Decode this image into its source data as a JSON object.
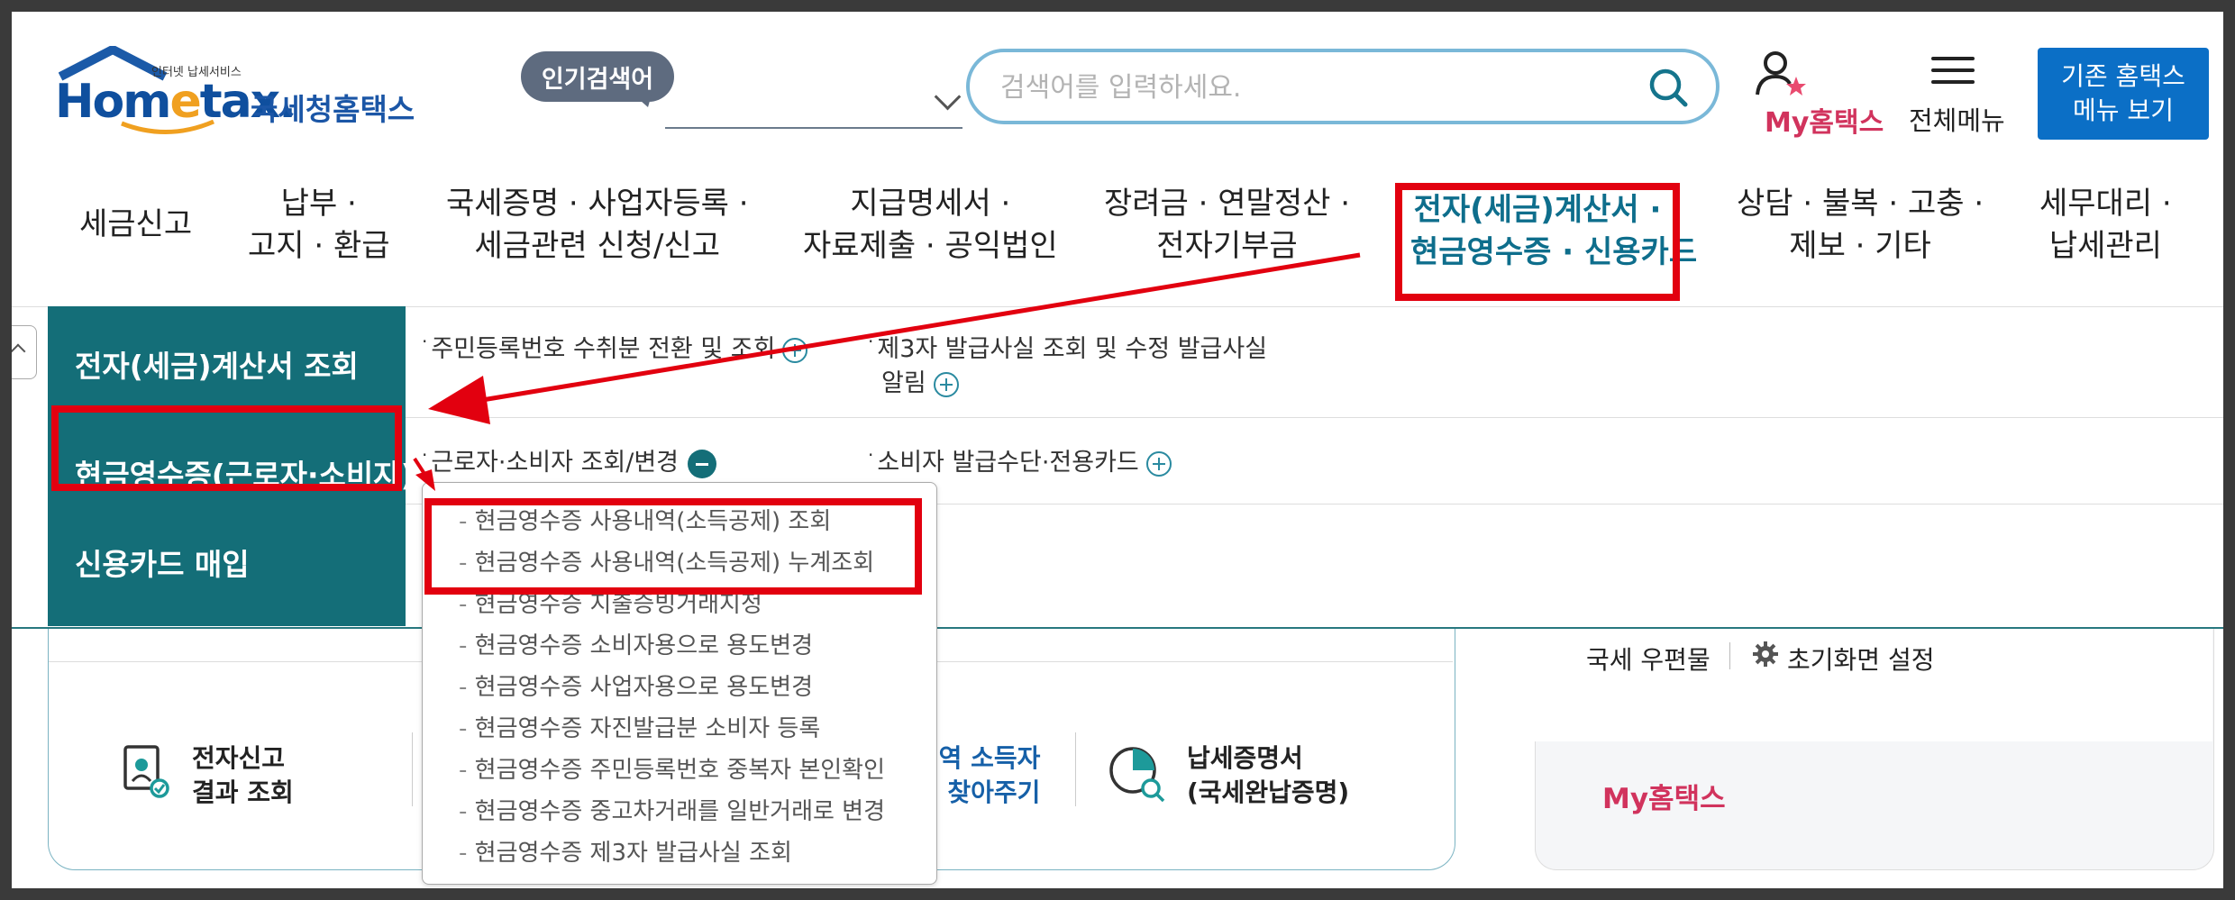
{
  "header": {
    "logo_sup": "인터넷 납세서비스",
    "logo_main_pre": "Hom",
    "logo_main_e": "e",
    "logo_main_post": "tax.",
    "logo_kor": "국세청홈택스",
    "popular_badge": "인기검색어",
    "search_placeholder": "검색어를 입력하세요.",
    "my_hometax": "My홈택스",
    "all_menu": "전체메뉴",
    "legacy_line1": "기존 홈택스",
    "legacy_line2": "메뉴 보기"
  },
  "nav": {
    "items": [
      {
        "line1": "세금신고",
        "line2": ""
      },
      {
        "line1": "납부 ·",
        "line2": "고지 · 환급"
      },
      {
        "line1": "국세증명 · 사업자등록 ·",
        "line2": "세금관련 신청/신고"
      },
      {
        "line1": "지급명세서 ·",
        "line2": "자료제출 · 공익법인"
      },
      {
        "line1": "장려금 · 연말정산 ·",
        "line2": "전자기부금"
      },
      {
        "line1": "전자(세금)계산서 ·",
        "line2": "현금영수증 · 신용카드"
      },
      {
        "line1": "상담 · 불복 · 고충 ·",
        "line2": "제보 · 기타"
      },
      {
        "line1": "세무대리 ·",
        "line2": "납세관리"
      }
    ]
  },
  "mega": {
    "side": [
      "전자(세금)계산서 조회",
      "현금영수증(근로자·소비자)",
      "신용카드 매입"
    ],
    "row1": {
      "a": "주민등록번호 수취분 전환 및 조회",
      "b_line1": "제3자 발급사실 조회 및 수정 발급사실",
      "b_line2": "알림"
    },
    "row2": {
      "a": "근로자·소비자 조회/변경",
      "b": "소비자 발급수단·전용카드"
    },
    "dropdown": [
      "현금영수증 사용내역(소득공제) 조회",
      "현금영수증 사용내역(소득공제) 누계조회",
      "현금영수증 지출증빙거래지정",
      "현금영수증 소비자용으로 용도변경",
      "현금영수증 사업자용으로 용도변경",
      "현금영수증 자진발급분 소비자 등록",
      "현금영수증 주민등록번호 중복자 본인확인",
      "현금영수증 중고차거래를 일반거래로 변경",
      "현금영수증 제3자 발급사실 조회"
    ]
  },
  "lower": {
    "shortcut1_line1": "전자신고",
    "shortcut1_line2": "결과 조회",
    "shortcut2_line1": "·역 소득자",
    "shortcut2_line2": "· 찾아주기",
    "shortcut3_line1": "납세증명서",
    "shortcut3_line2": "(국세완납증명)",
    "mail": "국세 우편물",
    "initial_setting": "초기화면 설정",
    "my_hometax": "My홈택스"
  },
  "colors": {
    "teal": "#146e78",
    "highlight_red": "#e2000f",
    "brand_blue": "#0b6fc6",
    "my_pink": "#d1335d"
  }
}
